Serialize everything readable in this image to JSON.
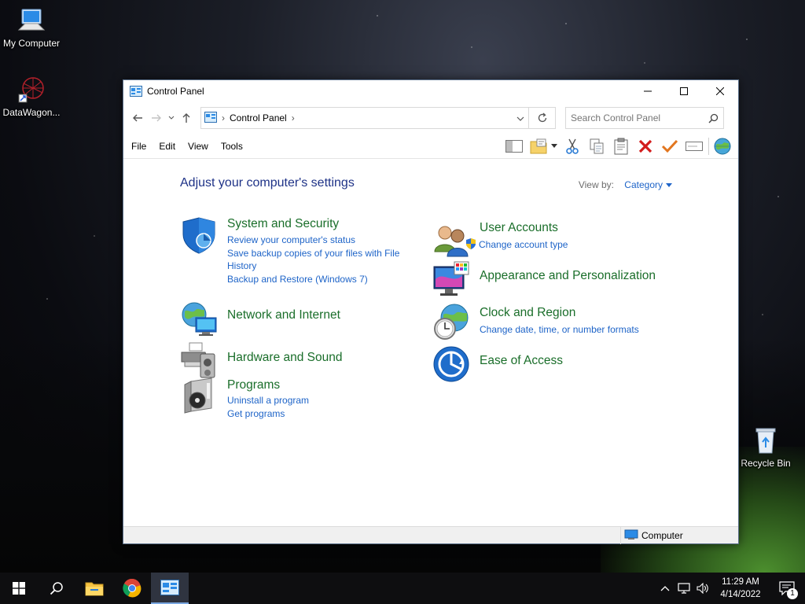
{
  "desktop": {
    "icons": [
      {
        "label": "My Computer"
      },
      {
        "label": "DataWagon..."
      },
      {
        "label": "Recycle Bin"
      }
    ]
  },
  "window": {
    "title": "Control Panel",
    "breadcrumb": [
      "Control Panel"
    ],
    "search_placeholder": "Search Control Panel",
    "menu": [
      "File",
      "Edit",
      "View",
      "Tools"
    ],
    "heading": "Adjust your computer's settings",
    "view_by_label": "View by:",
    "view_by_value": "Category",
    "categories": {
      "system": {
        "title": "System and Security",
        "links": [
          "Review your computer's status",
          "Save backup copies of your files with File History",
          "Backup and Restore (Windows 7)"
        ]
      },
      "network": {
        "title": "Network and Internet"
      },
      "hardware": {
        "title": "Hardware and Sound"
      },
      "programs": {
        "title": "Programs",
        "links": [
          "Uninstall a program",
          "Get programs"
        ]
      },
      "users": {
        "title": "User Accounts",
        "links": [
          "Change account type"
        ]
      },
      "appearance": {
        "title": "Appearance and Personalization"
      },
      "clock": {
        "title": "Clock and Region",
        "links": [
          "Change date, time, or number formats"
        ]
      },
      "ease": {
        "title": "Ease of Access"
      }
    },
    "status_location": "Computer"
  },
  "taskbar": {
    "time": "11:29 AM",
    "date": "4/14/2022",
    "notification_count": "1"
  },
  "colors": {
    "category_title": "#1a6e2a",
    "link": "#1e64c8",
    "heading": "#1e3287"
  }
}
